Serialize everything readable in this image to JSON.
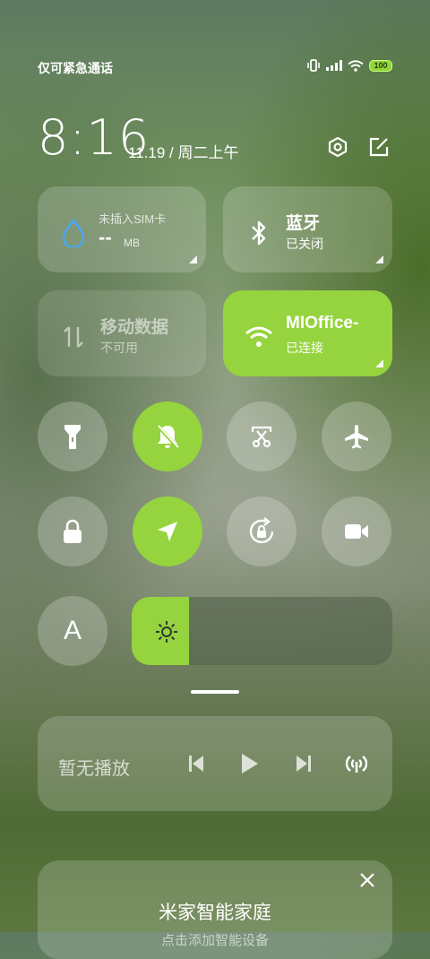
{
  "status_bar": {
    "carrier_text": "仅可紧急通话",
    "battery_level": "100",
    "icons": [
      "vibrate-icon",
      "signal-icon",
      "wifi-icon",
      "battery-icon"
    ]
  },
  "header": {
    "time": "8:16",
    "date": "11.19 / 周二上午",
    "icons": [
      "settings-icon",
      "edit-icon"
    ]
  },
  "tiles": {
    "data_usage": {
      "label": "未插入SIM卡",
      "value": "--",
      "unit": "MB",
      "icon": "water-drop-icon"
    },
    "bluetooth": {
      "title": "蓝牙",
      "status": "已关闭",
      "icon": "bluetooth-icon"
    },
    "mobile_data": {
      "title": "移动数据",
      "status": "不可用",
      "icon": "data-arrows-icon"
    },
    "wifi": {
      "title": "MIOffice-",
      "status": "已连接",
      "icon": "wifi-icon"
    }
  },
  "toggles": [
    {
      "name": "flashlight",
      "active": false,
      "icon": "flashlight-icon"
    },
    {
      "name": "mute",
      "active": true,
      "icon": "bell-off-icon"
    },
    {
      "name": "screenshot",
      "active": false,
      "icon": "scissors-icon"
    },
    {
      "name": "airplane",
      "active": false,
      "icon": "airplane-icon"
    },
    {
      "name": "lock",
      "active": false,
      "icon": "lock-icon"
    },
    {
      "name": "location",
      "active": true,
      "icon": "navigation-icon"
    },
    {
      "name": "rotation-lock",
      "active": false,
      "icon": "rotation-lock-icon"
    },
    {
      "name": "screen-record",
      "active": false,
      "icon": "video-camera-icon"
    }
  ],
  "auto_brightness": {
    "label": "A"
  },
  "brightness": {
    "level": 0.22,
    "icon": "sun-icon"
  },
  "media": {
    "status": "暂无播放",
    "icons": [
      "previous-icon",
      "play-icon",
      "next-icon",
      "cast-icon"
    ]
  },
  "smart_home": {
    "title": "米家智能家庭",
    "subtitle": "点击添加智能设备"
  },
  "colors": {
    "accent": "#95d43e",
    "tile_bg": "rgba(255,255,255,0.18)"
  }
}
